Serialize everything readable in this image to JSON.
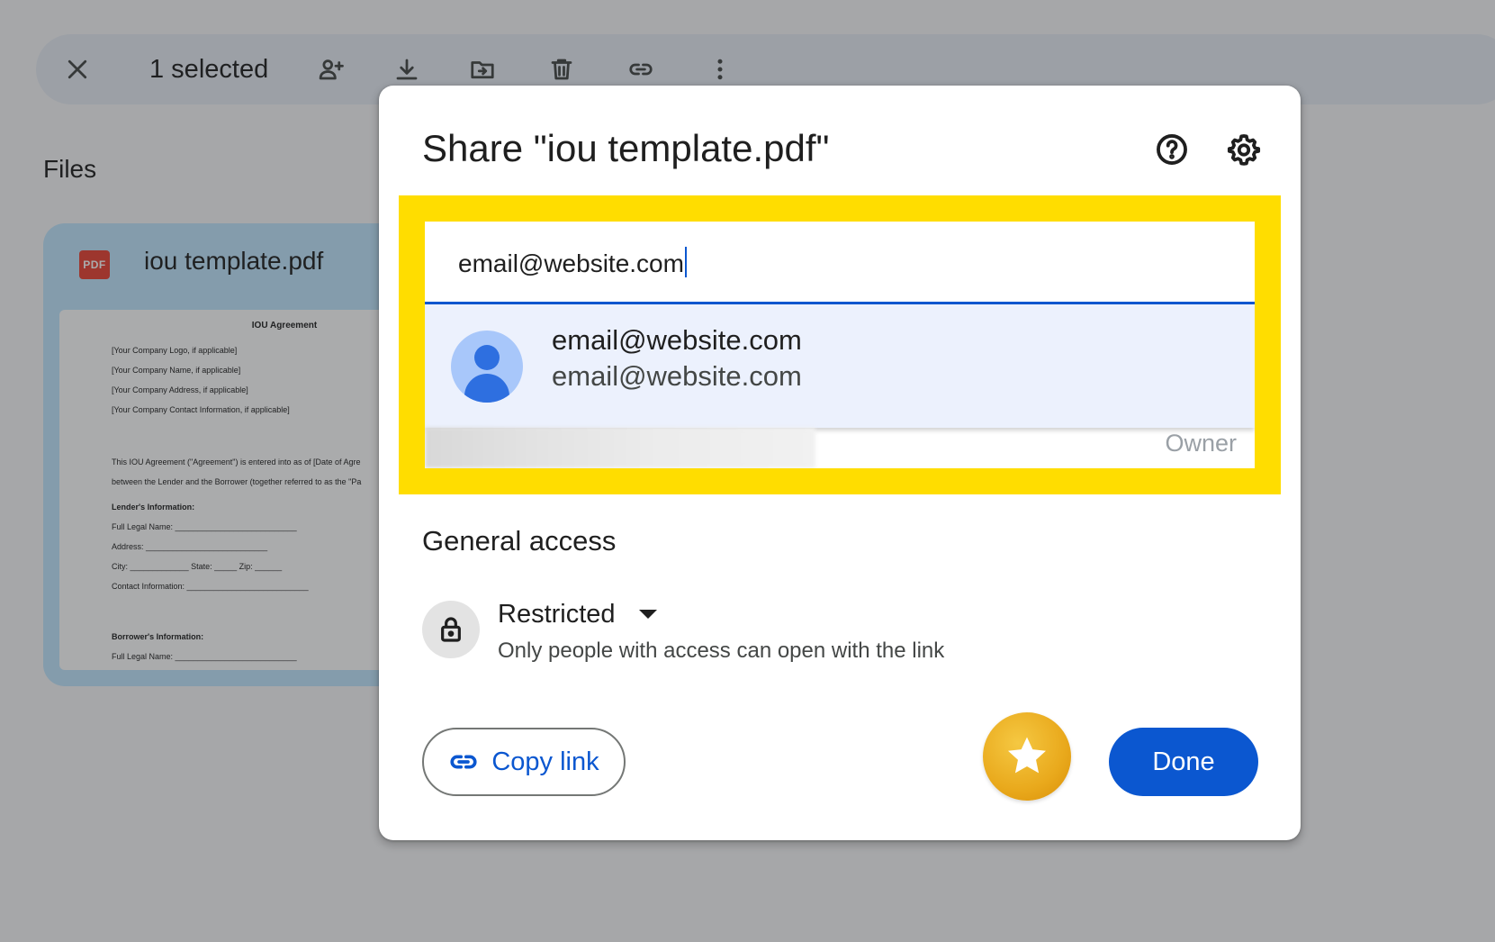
{
  "toolbar": {
    "selected_text": "1 selected",
    "icons": [
      "close-icon",
      "share-person-icon",
      "download-icon",
      "move-to-folder-icon",
      "trash-icon",
      "link-icon",
      "more-vert-icon"
    ]
  },
  "files": {
    "heading": "Files",
    "card": {
      "name": "iou template.pdf",
      "badge": "PDF",
      "preview": {
        "title": "IOU Agreement",
        "lines": [
          "[Your Company Logo, if applicable]",
          "[Your Company Name, if applicable]",
          "[Your Company Address, if applicable]",
          "[Your Company Contact Information, if applicable]",
          "This IOU Agreement (\"Agreement\") is entered into as of [Date of Agre",
          "between the Lender and the Borrower (together referred to as the \"Pa",
          "Lender's Information:",
          "Full Legal Name: ___________________________",
          "Address: ___________________________",
          "City: _____________ State: _____ Zip: ______",
          "Contact Information: ___________________________",
          "Borrower's Information:",
          "Full Legal Name: ___________________________"
        ]
      }
    }
  },
  "dialog": {
    "title": "Share \"iou template.pdf\"",
    "help_icon": "help-circle-icon",
    "settings_icon": "gear-icon",
    "input_value": "email@website.com",
    "suggestion": {
      "name": "email@website.com",
      "email": "email@website.com"
    },
    "owner_label": "Owner",
    "general_access_heading": "General access",
    "access_level": "Restricted",
    "access_description": "Only people with access can open with the link",
    "copy_link_label": "Copy link",
    "done_label": "Done"
  },
  "colors": {
    "accent": "#0b57d0",
    "highlight": "#ffdd00",
    "suggestion_bg": "#ecf1fd",
    "star_badge": "#e9a91c"
  }
}
